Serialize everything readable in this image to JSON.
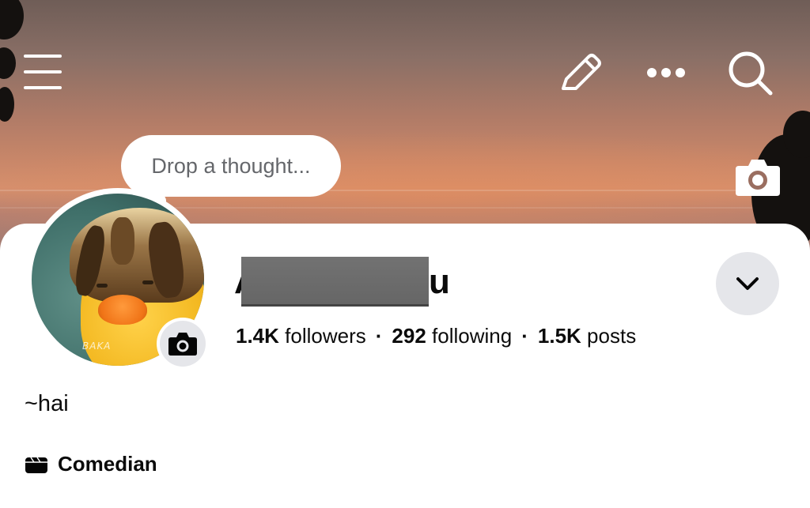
{
  "thought_bubble": {
    "placeholder": "Drop a thought..."
  },
  "profile": {
    "name_prefix": "A",
    "name_suffix": "u",
    "bio": "~hai",
    "category": "Comedian",
    "avatar_watermark": "BAKA"
  },
  "stats": {
    "followers_count": "1.4K",
    "followers_label": "followers",
    "following_count": "292",
    "following_label": "following",
    "posts_count": "1.5K",
    "posts_label": "posts",
    "separator": "·"
  },
  "icons": {
    "menu": "hamburger-menu-icon",
    "edit": "pencil-icon",
    "more": "more-dots-icon",
    "search": "search-icon",
    "cover_camera": "camera-icon",
    "avatar_camera": "camera-icon",
    "expand": "chevron-down-icon",
    "category": "clapperboard-icon"
  },
  "colors": {
    "accent_gray": "#e5e6ea",
    "text_primary": "#0b0b0b",
    "text_secondary": "#65676b"
  }
}
